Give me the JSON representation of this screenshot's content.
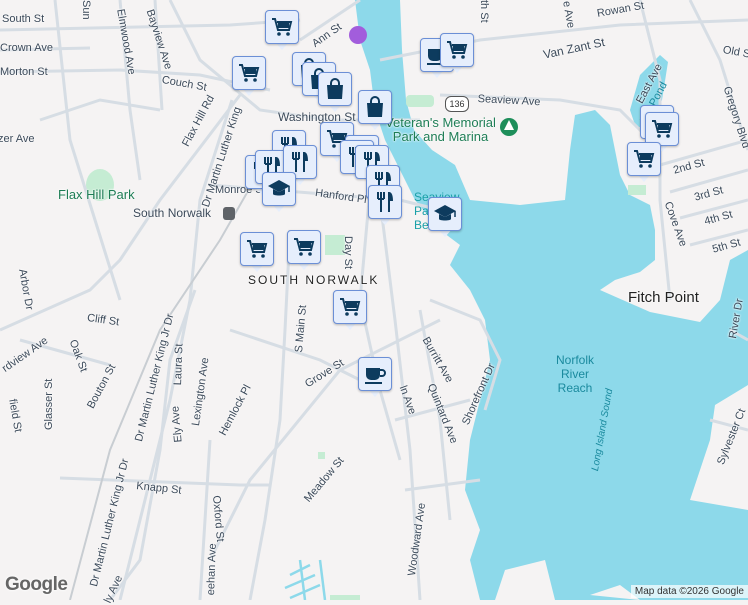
{
  "streets": [
    "South St",
    "Crown Ave",
    "Morton St",
    "Elmwood Ave",
    "Bayview Ave",
    "Couch St",
    "Flax Hill Rd",
    "Dr Martin Luther King",
    "Ann St",
    "Washington St",
    "Monroe St",
    "Hanford Pl",
    "Day St",
    "Arbor Dr",
    "zer Ave",
    "Van Zant St",
    "Rowan St",
    "Seaview Ave",
    "Old St",
    "Gregory Blvd",
    "East Ave",
    "2nd St",
    "3rd St",
    "4th St",
    "5th St",
    "Cove Ave",
    "River Dr",
    "Cliff St",
    "rdview Ave",
    "Oak St",
    "Bouton St",
    "Glasser St",
    "field St",
    "Laura St",
    "Ely Ave",
    "Lexington Ave",
    "Hemlock Pl",
    "S Main St",
    "Grove St",
    "Dr Martin Luther King Jr Dr",
    "Dr Martin Luther King Jr Dr",
    "Knapp St",
    "Oxford St",
    "Meadow St",
    "eehan Ave",
    "ly Ave",
    "Woodward Ave",
    "ln Ave",
    "Quintard Ave",
    "Burritt Ave",
    "Shorefront Dr",
    "Sylvester Ct",
    "th St",
    "e Ave",
    "Sun"
  ],
  "places": {
    "flax_hill_park": "Flax Hill Park",
    "station": "South Norwalk",
    "neighborhood": "SOUTH NORWALK",
    "veterans_park": "Veteran's Memorial Park and Marina",
    "seaview_park": "Seaview Park Beach",
    "norfolk_river": "Norfolk River Reach",
    "long_island_sound": "Long Island Sound",
    "mill_pond": "Mill Pond",
    "fitch_point": "Fitch Point"
  },
  "route_shield": "136",
  "markers": [
    "shopping-cart",
    "shopping-cart",
    "shopping-bag",
    "shopping-bag",
    "shopping-bag",
    "shopping-bag",
    "shopping-cart",
    "shopping-cart",
    "restaurant",
    "restaurant",
    "restaurant",
    "restaurant",
    "restaurant",
    "restaurant",
    "restaurant",
    "graduation-cap",
    "restaurant",
    "coffee-cup",
    "shopping-cart",
    "shopping-cart",
    "shopping-cart",
    "shopping-cart",
    "graduation-cap",
    "shopping-cart",
    "shopping-cart",
    "shopping-cart",
    "coffee-cup"
  ],
  "colors": {
    "water": "#8dd9ea",
    "land": "#f5f3f3",
    "road": "#d6dde4",
    "park": "#c5ecd3",
    "marker_fill": "#e6eefc",
    "marker_icon": "#0d3b5e"
  },
  "footer": {
    "logo": "Google",
    "attribution": "Map data ©2026 Google"
  }
}
